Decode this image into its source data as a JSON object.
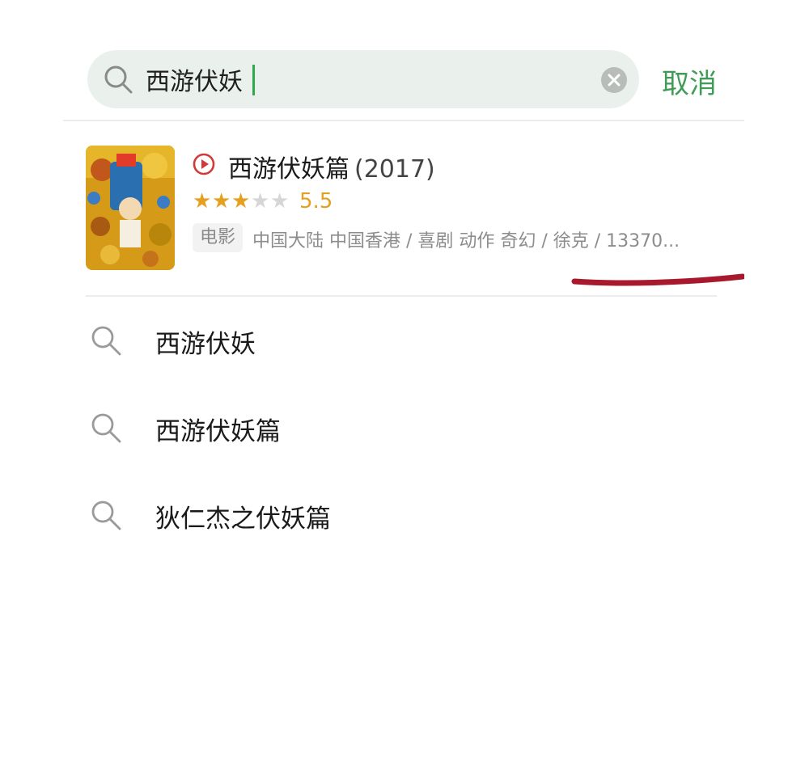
{
  "search": {
    "value": "西游伏妖",
    "cancel_label": "取消"
  },
  "result": {
    "title": "西游伏妖篇",
    "year": "(2017)",
    "rating": "5.5",
    "stars_filled": 3,
    "stars_total": 5,
    "type": "电影",
    "meta": "中国大陆 中国香港 / 喜剧 动作 奇幻 / 徐克 / 13370..."
  },
  "suggestions": [
    {
      "label": "西游伏妖"
    },
    {
      "label": "西游伏妖篇"
    },
    {
      "label": "狄仁杰之伏妖篇"
    }
  ],
  "colors": {
    "accent_green": "#3f9b55",
    "search_bg": "#eaf1ec",
    "star_filled": "#e6a020",
    "star_empty": "#d6d6d6",
    "play_red": "#d23a3a",
    "annotation_red": "#a8192e"
  },
  "icons": {
    "search": "search-icon",
    "clear": "clear-icon",
    "play": "play-circle-icon",
    "star": "star-icon"
  }
}
